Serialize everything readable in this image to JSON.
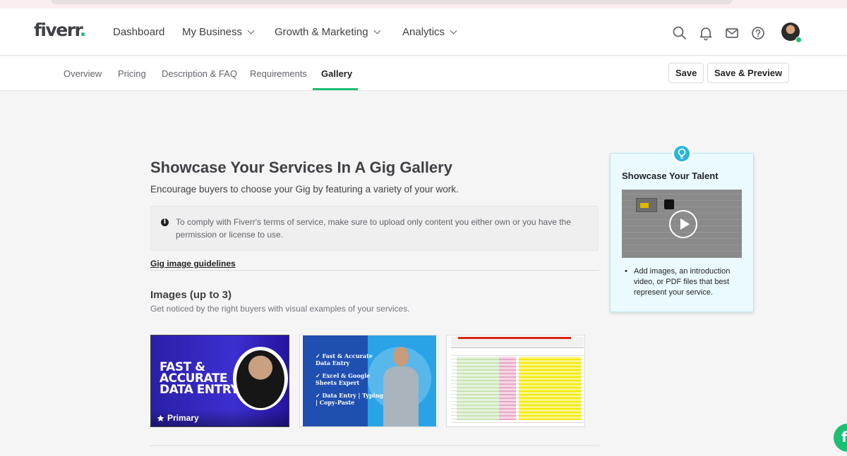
{
  "brand": {
    "logo_text": "fiverr",
    "logo_dot": ".",
    "accent": "#1dbf73"
  },
  "topnav": {
    "items": [
      {
        "label": "Dashboard"
      },
      {
        "label": "My Business"
      },
      {
        "label": "Growth & Marketing"
      },
      {
        "label": "Analytics"
      }
    ],
    "icons": [
      "search-icon",
      "bell-icon",
      "mail-icon",
      "help-icon",
      "avatar"
    ]
  },
  "subnav": {
    "tabs": [
      {
        "label": "Overview"
      },
      {
        "label": "Pricing"
      },
      {
        "label": "Description & FAQ"
      },
      {
        "label": "Requirements"
      },
      {
        "label": "Gallery",
        "active": true
      }
    ],
    "save_label": "Save",
    "save_preview_label": "Save & Preview"
  },
  "main": {
    "title": "Showcase Your Services In A Gig Gallery",
    "subtitle": "Encourage buyers to choose your Gig by featuring a variety of your work.",
    "notice": "To comply with Fiverr's terms of service, make sure to upload only content you either own or you have the permission or license to use.",
    "guidelines_link": "Gig image guidelines",
    "images_heading": "Images (up to 3)",
    "images_subheading": "Get noticed by the right buyers with visual examples of your services.",
    "thumbnails": [
      {
        "headline_lines": [
          "FAST &",
          "ACCURATE",
          "DATA ENTRY"
        ],
        "badge": "Primary"
      },
      {
        "bullets": [
          "✓ Fast & Accurate\nData Entry",
          "✓ Excel & Google\nSheets Expert",
          "✓ Data Entry | Typing\n| Copy-Paste"
        ]
      },
      {
        "sheet_title": "spreadsheet screenshot"
      }
    ]
  },
  "tip": {
    "title": "Showcase Your Talent",
    "bullet": "Add images, an introduction video, or PDF files that best represent your service."
  },
  "chat_fab": {
    "label": "f"
  }
}
